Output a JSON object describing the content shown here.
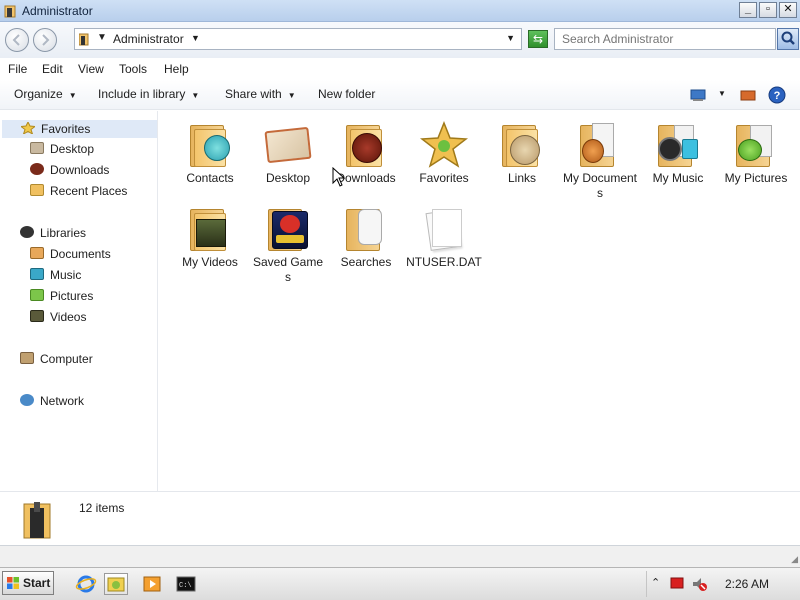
{
  "window": {
    "title": "Administrator",
    "controls": {
      "minimize": "_",
      "maximize": "▫",
      "close": "✕"
    }
  },
  "address": {
    "breadcrumb": "Administrator",
    "search_placeholder": "Search Administrator"
  },
  "menu": [
    "File",
    "Edit",
    "View",
    "Tools",
    "Help"
  ],
  "commands": {
    "organize": "Organize",
    "include_in_library": "Include in library",
    "share_with": "Share with",
    "new_folder": "New folder"
  },
  "sidebar": {
    "favorites": {
      "label": "Favorites",
      "items": [
        "Desktop",
        "Downloads",
        "Recent Places"
      ]
    },
    "libraries": {
      "label": "Libraries",
      "items": [
        "Documents",
        "Music",
        "Pictures",
        "Videos"
      ]
    },
    "computer": "Computer",
    "network": "Network"
  },
  "files": [
    {
      "name": "Contacts"
    },
    {
      "name": "Desktop"
    },
    {
      "name": "Downloads"
    },
    {
      "name": "Favorites"
    },
    {
      "name": "Links"
    },
    {
      "name": "My Documents"
    },
    {
      "name": "My Music"
    },
    {
      "name": "My Pictures"
    },
    {
      "name": "My Videos"
    },
    {
      "name": "Saved Games"
    },
    {
      "name": "Searches"
    },
    {
      "name": "NTUSER.DAT"
    }
  ],
  "details": {
    "item_count": "12 items"
  },
  "taskbar": {
    "start_label": "Start",
    "clock": "2:26 AM"
  },
  "colors": {
    "titlebar": "#c5d8f0",
    "selection": "#dfe9f7",
    "folder": "#f3c46b",
    "help_blue": "#2b62c0"
  }
}
